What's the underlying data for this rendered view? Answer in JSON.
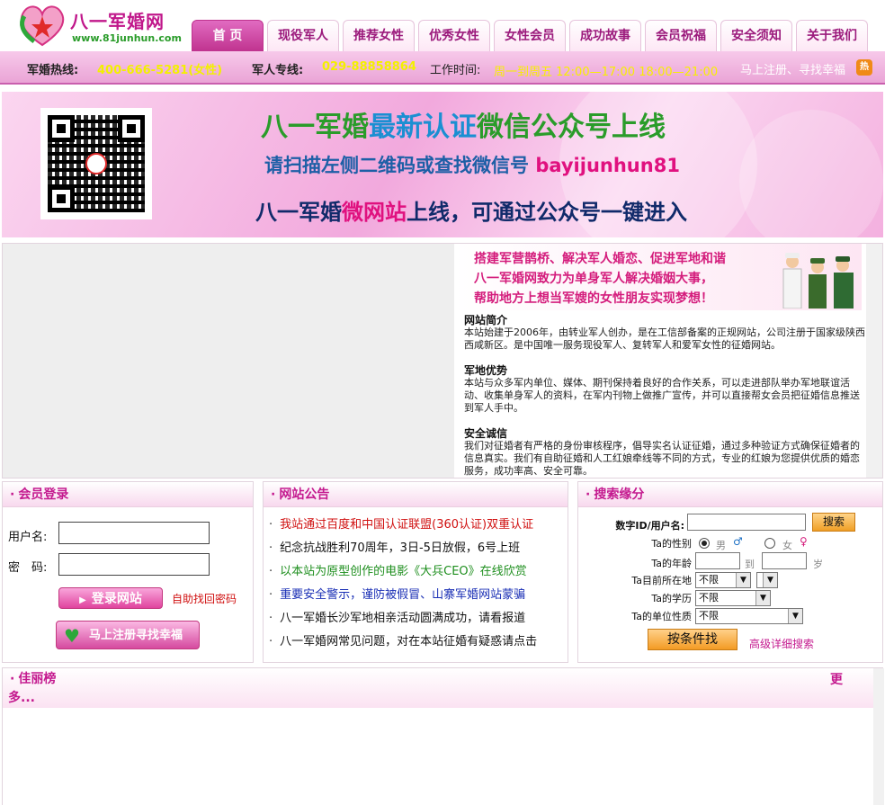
{
  "logo": {
    "title": "八一军婚网",
    "url": "www.81junhun.com"
  },
  "nav": {
    "tabs": [
      "首 页",
      "现役军人",
      "推荐女性",
      "优秀女性",
      "女性会员",
      "成功故事",
      "会员祝福",
      "安全须知",
      "关于我们"
    ],
    "active": 0
  },
  "hotline": {
    "label1": "军婚热线:",
    "phone1": "400-666-5281(女性)",
    "label2": "军人专线:",
    "phone2": "029-88858864",
    "label3": "工作时间:",
    "hours": "周一到周五 12:00—17:00 18:00—21:00",
    "register": "马上注册、寻找幸福",
    "hot_badge": "热"
  },
  "banner": {
    "line1_a": "八一军婚",
    "line1_b": "最新认证",
    "line1_c": "微信公众号上线",
    "line2_a": "请扫描左侧二维码或查找微信号",
    "line2_b": "bayijunhun81",
    "line3_a": "八一军婚",
    "line3_b": "微网站",
    "line3_c": "上线，可通过公众号一键进入"
  },
  "intro_banner": {
    "line1": "搭建军营鹊桥、解决军人婚恋、促进军地和谐",
    "line2": "八一军婚网致力为单身军人解决婚姻大事，",
    "line3": "帮助地方上想当军嫂的女性朋友实现梦想！"
  },
  "intro": {
    "sections": [
      {
        "title": "网站简介",
        "text": "本站始建于2006年，由转业军人创办，是在工信部备案的正规网站，公司注册于国家级陕西西咸新区。是中国唯一服务现役军人、复转军人和爱军女性的征婚网站。"
      },
      {
        "title": "军地优势",
        "text": "本站与众多军内单位、媒体、期刊保持着良好的合作关系，可以走进部队举办军地联谊活动、收集单身军人的资料，在军内刊物上做推广宣传，并可以直接帮女会员把征婚信息推送到军人手中。"
      },
      {
        "title": "安全诚信",
        "text": "我们对征婚者有严格的身份审核程序，倡导实名认证征婚，通过多种验证方式确保征婚者的信息真实。我们有自助征婚和人工红娘牵线等不同的方式，专业的红娘为您提供优质的婚恋服务，成功率高、安全可靠。"
      }
    ]
  },
  "login": {
    "title": "会员登录",
    "username_label": "用户名:",
    "password_label": "密　码:",
    "login_button": "登录网站",
    "forgot": "自助找回密码",
    "register_button": "马上注册寻找幸福"
  },
  "notice": {
    "title": "网站公告",
    "items": [
      {
        "text": "我站通过百度和中国认证联盟(360认证)双重认证",
        "color": "#d01010"
      },
      {
        "text": "纪念抗战胜利70周年，3日-5日放假，6号上班",
        "color": "#111111"
      },
      {
        "text": "以本站为原型创作的电影《大兵CEO》在线欣赏",
        "color": "#1f8f1f"
      },
      {
        "text": "重要安全警示，谨防被假冒、山寨军婚网站蒙骗",
        "color": "#1a2fb5"
      },
      {
        "text": "八一军婚长沙军地相亲活动圆满成功，请看报道",
        "color": "#111111"
      },
      {
        "text": "八一军婚网常见问题，对在本站征婚有疑惑请点击",
        "color": "#111111"
      }
    ]
  },
  "search": {
    "title": "搜索缘分",
    "id_label": "数字ID/用户名:",
    "search_button": "搜索",
    "gender_label": "Ta的性别",
    "male": "男",
    "female": "女",
    "age_label": "Ta的年龄",
    "age_to": "到",
    "age_unit": "岁",
    "location_label": "Ta目前所在地",
    "location_value": "不限",
    "education_label": "Ta的学历",
    "education_value": "不限",
    "unit_label": "Ta的单位性质",
    "unit_value": "不限",
    "cond_button": "按条件找",
    "advanced": "高级详细搜索"
  },
  "beauty": {
    "title": "佳丽榜",
    "more_a": "更",
    "more_b": "多..."
  },
  "colors": {
    "brand": "#c41a8f",
    "nav_active": "#c0338f",
    "hotline_bg": "#eaa4d6",
    "highlight": "#f3f000"
  }
}
